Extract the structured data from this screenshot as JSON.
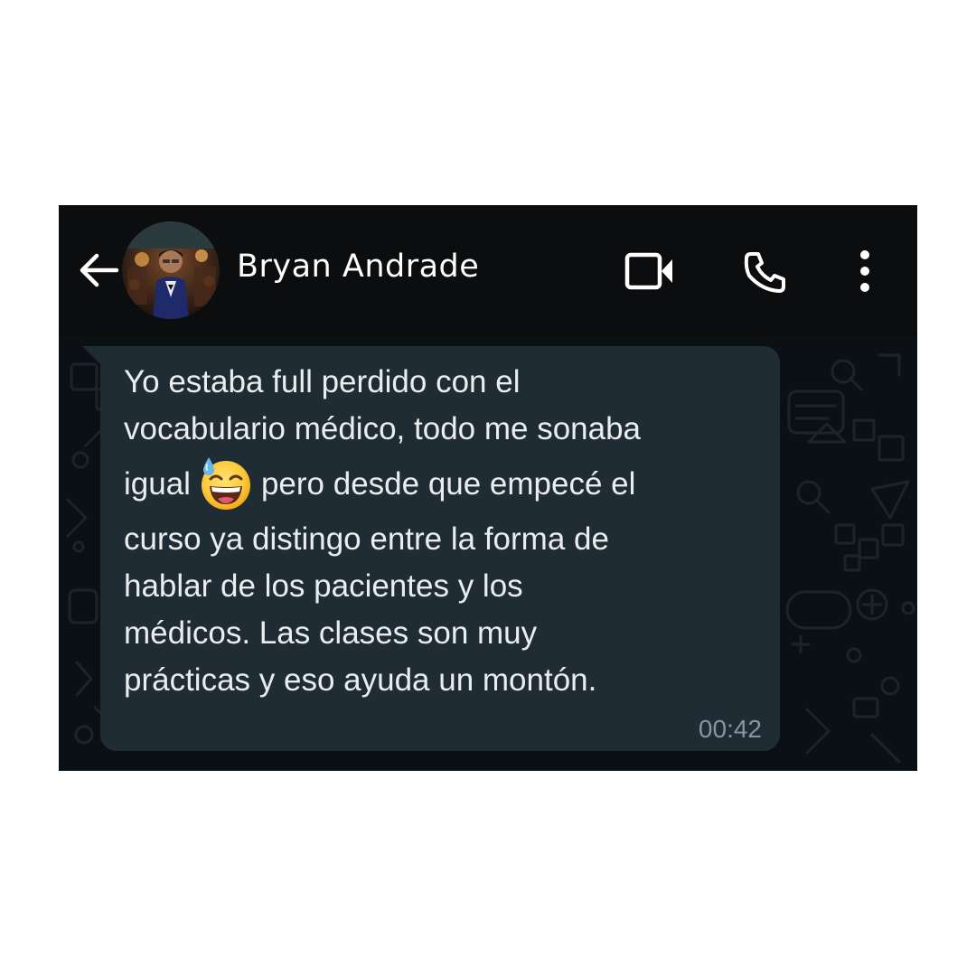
{
  "header": {
    "contact_name": "Bryan Andrade",
    "icons": {
      "back": "arrow-left-icon",
      "video": "video-call-icon",
      "call": "phone-icon",
      "menu": "more-vertical-icon"
    }
  },
  "message": {
    "lines": [
      "Yo estaba full perdido con el",
      "vocabulario médico, todo me sonaba",
      "igual",
      "pero desde que empecé el",
      "curso ya distingo entre la forma de",
      "hablar de los pacientes y los",
      "médicos. Las clases son muy",
      "prácticas y eso ayuda un montón."
    ],
    "emoji": "grinning-face-with-sweat",
    "time": "00:42"
  },
  "colors": {
    "header_bg": "#0b0d0f",
    "chat_bg": "#0b1014",
    "bubble_bg": "#202c33",
    "text": "#e9edef",
    "timestamp": "#8696a0"
  }
}
